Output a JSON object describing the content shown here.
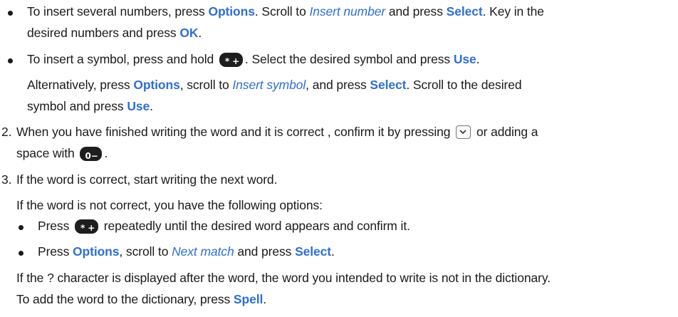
{
  "lines": {
    "l1": {
      "a": "To insert several numbers, press ",
      "b1": "Options",
      "c": ". Scroll to ",
      "i1": "Insert number",
      "d": " and press ",
      "b2": "Select",
      "e": ". Key in the"
    },
    "l2": {
      "a": "desired numbers and press ",
      "b1": "OK",
      "c": "."
    },
    "l3": {
      "a": "To insert a symbol, press and hold ",
      "c": ". Select the desired symbol and press ",
      "b1": "Use",
      "d": "."
    },
    "l4": {
      "a": "Alternatively, press ",
      "b1": "Options",
      "c": ", scroll to ",
      "i1": "Insert symbol",
      "d": ", and press ",
      "b2": "Select",
      "e": ". Scroll to the desired"
    },
    "l5": {
      "a": "symbol and press ",
      "b1": "Use",
      "c": "."
    },
    "l6": {
      "n": "2.",
      "a": "When you have finished writing the word and it is correct , confirm it by pressing ",
      "c": " or adding a"
    },
    "l7": {
      "a": "space with ",
      "c": "."
    },
    "l8": {
      "n": "3.",
      "a": "If the word is correct, start writing the next word."
    },
    "l9": {
      "a": "If the word is not correct, you have the following options:"
    },
    "l10": {
      "a": "Press ",
      "c": " repeatedly until the desired word appears and confirm it."
    },
    "l11": {
      "a": "Press ",
      "b1": "Options",
      "c": ", scroll to ",
      "i1": "Next match",
      "d": " and press ",
      "b2": "Select",
      "e": "."
    },
    "l12": {
      "a": "If the ? character is displayed after the word, the word you intended to write is not in the dictionary."
    },
    "l13": {
      "a": "To add the word to the dictionary, press ",
      "b1": "Spell",
      "c": "."
    }
  },
  "icons": {
    "star_key": "star-plus-key-icon",
    "zero_key": "zero-space-key-icon",
    "nav_key": "navi-down-key-icon"
  },
  "colors": {
    "accent": "#2f6fd3",
    "text": "#1a1a1a",
    "key": "#1e1e1e"
  }
}
